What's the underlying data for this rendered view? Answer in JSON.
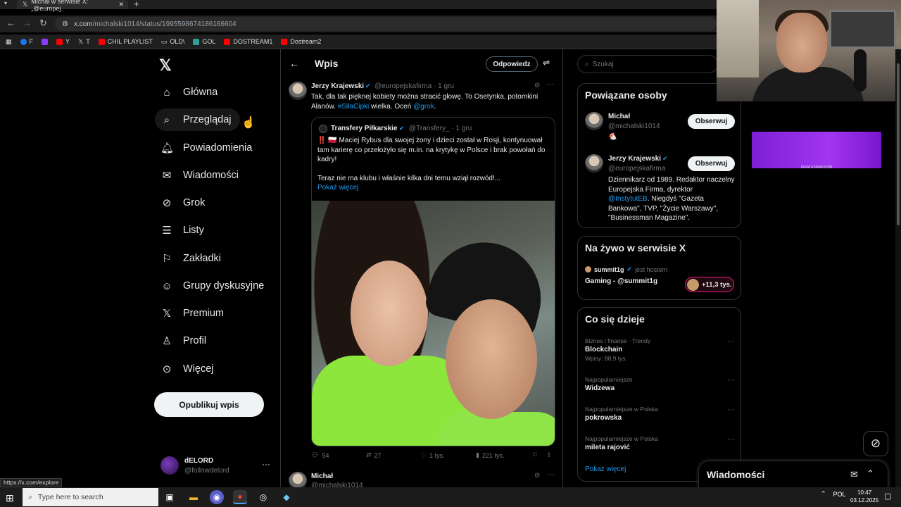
{
  "browser": {
    "tab_title": "Michał w serwisie X: „@europej",
    "url_host": "x.com",
    "url_path": "/michalski1014/status/1995598674186166604",
    "bookmarks": [
      {
        "label": "F",
        "color": "#1877f2"
      },
      {
        "label": "",
        "color": "#8b3dff"
      },
      {
        "label": "Y",
        "color": "#ff0000"
      },
      {
        "label": "T",
        "color": "#ffffff"
      },
      {
        "label": "CHIL PLAYLIST",
        "color": "#ff0000"
      },
      {
        "label": "OLD\\",
        "color": "#c9a227"
      },
      {
        "label": "GOL",
        "color": "#2aa198"
      },
      {
        "label": "DOSTREAM1",
        "color": "#ff0000"
      },
      {
        "label": "Dostream2",
        "color": "#ff0000"
      }
    ],
    "status_url": "https://x.com/explore"
  },
  "nav": {
    "items": [
      {
        "label": "Główna",
        "icon": "home-icon"
      },
      {
        "label": "Przeglądaj",
        "icon": "search-icon"
      },
      {
        "label": "Powiadomienia",
        "icon": "bell-icon"
      },
      {
        "label": "Wiadomości",
        "icon": "mail-icon"
      },
      {
        "label": "Grok",
        "icon": "grok-icon"
      },
      {
        "label": "Listy",
        "icon": "list-icon"
      },
      {
        "label": "Zakładki",
        "icon": "bookmark-icon"
      },
      {
        "label": "Grupy dyskusyjne",
        "icon": "groups-icon"
      },
      {
        "label": "Premium",
        "icon": "x-icon"
      },
      {
        "label": "Profil",
        "icon": "profile-icon"
      },
      {
        "label": "Więcej",
        "icon": "more-icon"
      }
    ],
    "post_button": "Opublikuj wpis",
    "account": {
      "name": "dELORD",
      "handle": "@followdelord"
    }
  },
  "main": {
    "title": "Wpis",
    "reply_button": "Odpowiedz",
    "tweet": {
      "name": "Jerzy Krajewski",
      "handle": "@europejskafirma · 1 gru",
      "text_before": "Tak, dla tak pięknej kobiety można stracić głowę. To Osetynka, potomkini Alanów. ",
      "hashtag": "#SiłaCipki",
      "text_mid": " wielka. Oceń ",
      "mention": "@grok",
      "text_end": "."
    },
    "quote": {
      "name": "Transfery Piłkarskie",
      "handle": "@Transfery_ · 1 gru",
      "text1": "‼️ 🇵🇱 Maciej Rybus dla swojej żony i dzieci został w Rosji, kontynuował tam karierę co przełożyło się m.in. na krytykę w Polsce i brak powołań do kadry!",
      "text2": "Teraz nie ma klubu i właśnie kilka dni temu wziął rozwód!...",
      "show_more": "Pokaż więcej"
    },
    "actions": {
      "replies": "54",
      "reposts": "27",
      "likes": "1 tys.",
      "views": "221 tys."
    },
    "next_tweet": {
      "name": "Michał",
      "handle": "@michalski1014"
    }
  },
  "sidebar": {
    "search_placeholder": "Szukaj",
    "related": {
      "title": "Powiązane osoby",
      "people": [
        {
          "name": "Michał",
          "handle": "@michalski1014",
          "bio": "🐔",
          "follow": "Obserwuj"
        },
        {
          "name": "Jerzy Krajewski",
          "handle": "@europejskafirma",
          "bio_pre": "Dziennikarz od 1989. Redaktor naczelny Europejska Firma, dyrektor ",
          "bio_link": "@InstytutEB",
          "bio_post": ". Niegdyś \"Gazeta Bankowa\", TVP, \"Życie Warszawy\", \"Businessman Magazine\".",
          "follow": "Obserwuj"
        }
      ]
    },
    "live": {
      "title": "Na żywo w serwisie X",
      "host": "summit1g",
      "host_suffix": "jest hostem",
      "stream_title": "Gaming - @summit1g",
      "viewers": "+11,3 tys."
    },
    "trends": {
      "title": "Co się dzieje",
      "items": [
        {
          "meta": "Biznes i finanse · Trendy",
          "topic": "Blockchain",
          "posts": "Wpisy: 88,9 tys."
        },
        {
          "meta": "Najpopularniejsze",
          "topic": "Widzewa",
          "posts": ""
        },
        {
          "meta": "Najpopularniejsze w Polska",
          "topic": "pokrowska",
          "posts": ""
        },
        {
          "meta": "Najpopularniejsze w Polska",
          "topic": "mileta rajović",
          "posts": ""
        }
      ],
      "show_more": "Pokaż więcej"
    }
  },
  "ad": {
    "text": "PIRATESWAP.COM"
  },
  "dock": {
    "messages": "Wiadomości"
  },
  "taskbar": {
    "search_placeholder": "Type here to search",
    "lang": "POL",
    "time": "10:47",
    "date": "03.12.2025"
  }
}
